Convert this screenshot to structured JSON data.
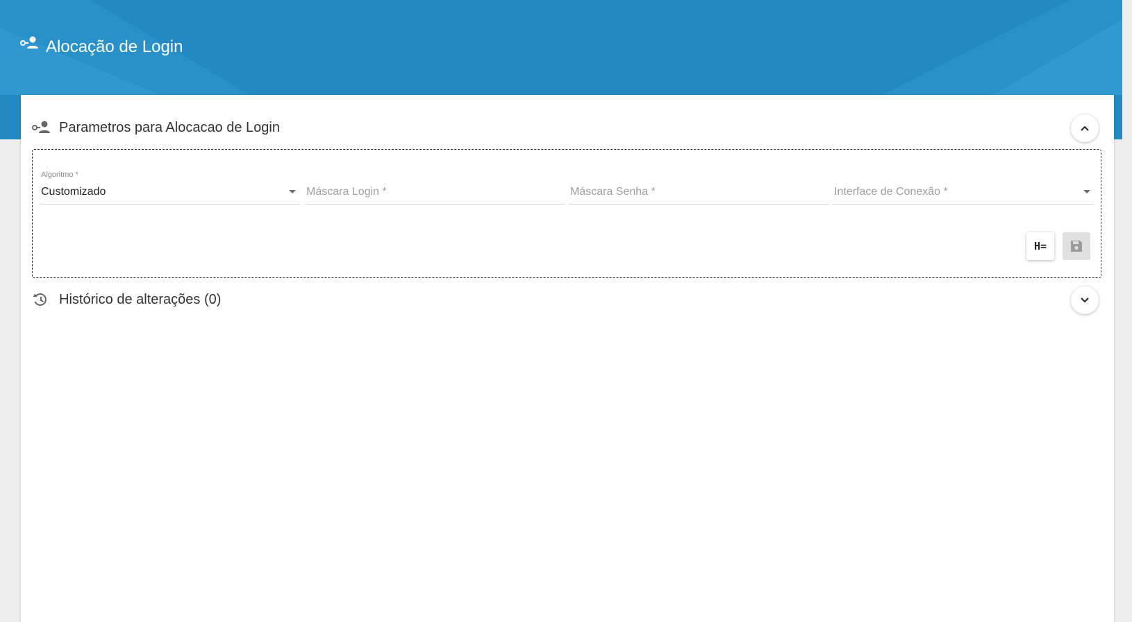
{
  "page": {
    "title": "Alocação de Login",
    "title_icon": "user-key-icon"
  },
  "params_section": {
    "title": "Parametros para Alocacao de Login",
    "icon": "user-key-icon",
    "toggle_icon": "chevron-up-icon",
    "fields": {
      "algoritmo": {
        "label": "Algoritmo *",
        "value": "Customizado"
      },
      "mascara_login": {
        "placeholder": "Máscara Login *",
        "value": ""
      },
      "mascara_senha": {
        "placeholder": "Máscara Senha *",
        "value": ""
      },
      "interface_conexao": {
        "placeholder": "Interface de Conexão *",
        "value": ""
      }
    },
    "buttons": {
      "header_label": "H=",
      "save_icon": "floppy-disk-icon"
    }
  },
  "history_section": {
    "title": "Histórico de alterações (0)",
    "icon": "history-icon",
    "toggle_icon": "chevron-down-icon"
  },
  "colors": {
    "banner": "#2389c3",
    "banner_light": "#3aa4dc",
    "text": "#333333"
  }
}
